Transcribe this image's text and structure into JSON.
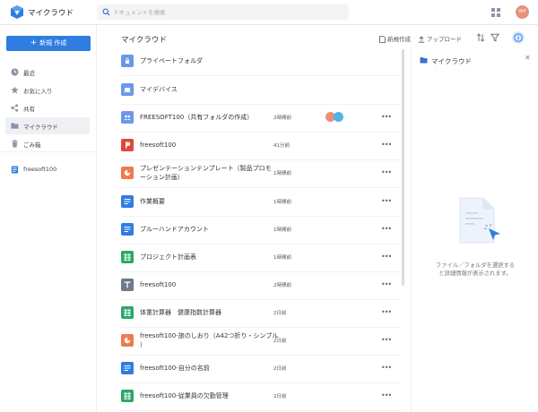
{
  "app": {
    "title": "マイクラウド",
    "avatar_initials": "WP",
    "avatar_color": "#e8917a",
    "accent": "#2f7de1"
  },
  "search": {
    "placeholder": "ドキュメントを検索"
  },
  "sidebar": {
    "new_label": "新規 作成",
    "items": [
      {
        "label": "最近",
        "icon": "clock-icon"
      },
      {
        "label": "お気に入り",
        "icon": "star-icon"
      },
      {
        "label": "共有",
        "icon": "share-icon"
      },
      {
        "label": "マイクラウド",
        "icon": "folder-icon",
        "active": true
      },
      {
        "label": "ごみ箱",
        "icon": "trash-icon"
      }
    ],
    "team": {
      "label": "freesoft100",
      "icon": "team-doc-icon"
    }
  },
  "main": {
    "title": "マイクラウド",
    "toolbar": {
      "new_label": "新規作成",
      "upload_label": "アップロード"
    },
    "rows": [
      {
        "name": "プライベートフォルダ",
        "date": "",
        "icon": "folder-lock-icon",
        "color": "#6b98e8",
        "more": false
      },
      {
        "name": "マイデバイス",
        "date": "",
        "icon": "folder-device-icon",
        "color": "#6b98e8",
        "more": false
      },
      {
        "name": "FREESOFT100（共有フォルダの作成）",
        "date": "2時間前",
        "icon": "folder-shared-icon",
        "color": "#6b98e8",
        "more": true,
        "shared": true
      },
      {
        "name": "freesoft100",
        "date": "41分前",
        "icon": "presentation-icon",
        "color": "#e2453a",
        "more": true
      },
      {
        "name": "プレゼンテーションテンプレート（製品プロモーション計画）",
        "line1": "プレゼンテーションテンプレート（製品プロモ",
        "line2": "ーション計画）",
        "date": "1時間前",
        "icon": "slides-icon",
        "color": "#ef7b4c",
        "more": true
      },
      {
        "name": "作業概要",
        "date": "1時間前",
        "icon": "document-icon",
        "color": "#2f7de1",
        "more": true
      },
      {
        "name": "ブルーハンドアカウント",
        "date": "1時間前",
        "icon": "document-icon",
        "color": "#2f7de1",
        "more": true
      },
      {
        "name": "プロジェクト計画表",
        "date": "1時間前",
        "icon": "spreadsheet-icon",
        "color": "#2aa86a",
        "more": true
      },
      {
        "name": "freesoft100",
        "date": "2時間前",
        "icon": "text-icon",
        "color": "#6e7a8a",
        "more": true
      },
      {
        "name": "体重計算器　健康指数計算器",
        "date": "2日前",
        "icon": "spreadsheet-icon",
        "color": "#2aa86a",
        "more": true
      },
      {
        "name": "freesoft100-旅のしおり（A4 2つ折り・シンプル）",
        "line1": "freesoft100-旅のしおり（A42つ折り・シンプル",
        "line2": "）",
        "date": "2日前",
        "icon": "slides-icon",
        "color": "#ef7b4c",
        "more": true
      },
      {
        "name": "freesoft100-自分の名前",
        "date": "2日前",
        "icon": "document-icon",
        "color": "#2f7de1",
        "more": true
      },
      {
        "name": "freesoft100-従業員の欠勤管理",
        "date": "2日前",
        "icon": "spreadsheet-icon",
        "color": "#2aa86a",
        "more": true
      }
    ]
  },
  "panel": {
    "title": "マイクラウド",
    "empty_line1": "ファイル／フォルダを選択する",
    "empty_line2": "と詳細情報が表示されます。"
  }
}
